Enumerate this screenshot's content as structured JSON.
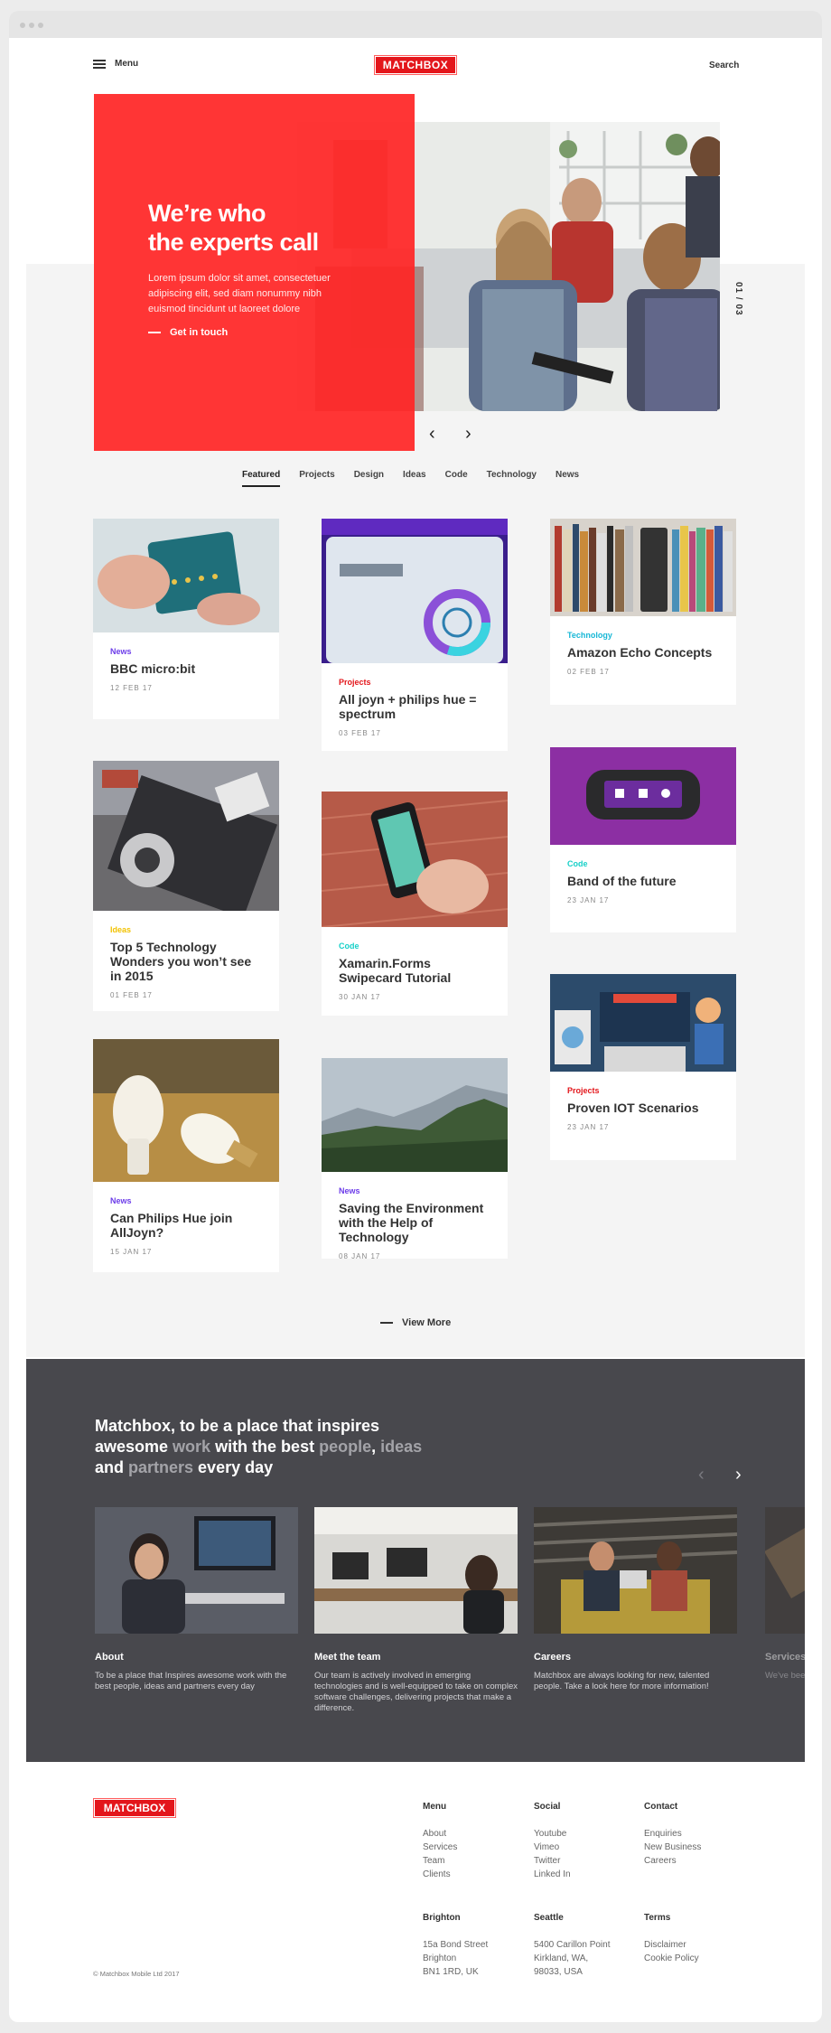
{
  "header": {
    "menu_label": "Menu",
    "logo": "MATCHBOX",
    "search_label": "Search"
  },
  "hero": {
    "title_line1": "We’re who",
    "title_line2": "the experts call",
    "body": "Lorem ipsum dolor sit amet, consectetuer adipiscing elit, sed diam nonummy nibh euismod tincidunt ut laoreet dolore",
    "cta": "Get in touch",
    "slide_counter": "01 / 03",
    "prev_icon": "chevron-left-icon",
    "next_icon": "chevron-right-icon"
  },
  "tabs": [
    "Featured",
    "Projects",
    "Design",
    "Ideas",
    "Code",
    "Technology",
    "News"
  ],
  "colors": {
    "brand_red": "#e3161b",
    "news": "#6c3ce9",
    "projects": "#e3161b",
    "technology": "#17b7d6",
    "code": "#17d0c8",
    "ideas": "#f2c200",
    "dark_bg": "#48484d"
  },
  "cards": [
    {
      "category": "News",
      "title": "BBC micro:bit",
      "date": "12 FEB 17"
    },
    {
      "category": "Projects",
      "title": "All joyn + philips hue = spectrum",
      "date": "03 FEB 17"
    },
    {
      "category": "Technology",
      "title": "Amazon Echo Concepts",
      "date": "02 FEB 17"
    },
    {
      "category": "Ideas",
      "title": "Top 5 Technology Wonders you won’t see in 2015",
      "date": "01 FEB 17"
    },
    {
      "category": "Code",
      "title": "Xamarin.Forms Swipecard Tutorial",
      "date": "30 JAN 17"
    },
    {
      "category": "Code",
      "title": "Band of the future",
      "date": "23 JAN 17"
    },
    {
      "category": "News",
      "title": "Can Philips Hue join AllJoyn?",
      "date": "15 JAN 17"
    },
    {
      "category": "News",
      "title": "Saving the Environment with the Help of Technology",
      "date": "08 JAN 17"
    },
    {
      "category": "Projects",
      "title": "Proven IOT Scenarios",
      "date": "23 JAN 17"
    }
  ],
  "view_more": "View More",
  "about": {
    "tagline_1": "Matchbox, to be a place that inspires",
    "tagline_2a": "awesome ",
    "tagline_2b": "work",
    "tagline_2c": " with the best ",
    "tagline_2d": "people",
    "tagline_2e": ", ",
    "tagline_2f": "ideas",
    "tagline_3a": "and ",
    "tagline_3b": "partners",
    "tagline_3c": " every day",
    "panels": [
      {
        "title": "About",
        "body": "To be a place that Inspires awesome work with the best people, ideas and partners every day"
      },
      {
        "title": "Meet the team",
        "body": "Our team is actively involved in emerging technologies and is well-equipped to take on complex software challenges, delivering projects that make a difference."
      },
      {
        "title": "Careers",
        "body": "Matchbox are always looking for new, talented people. Take a look here for more information!"
      },
      {
        "title": "Services",
        "body": "We've been d development when real sk"
      }
    ]
  },
  "footer": {
    "logo": "MATCHBOX",
    "menu": {
      "heading": "Menu",
      "links": [
        "About",
        "Services",
        "Team",
        "Clients"
      ]
    },
    "social": {
      "heading": "Social",
      "links": [
        "Youtube",
        "Vimeo",
        "Twitter",
        "Linked In"
      ]
    },
    "contact": {
      "heading": "Contact",
      "links": [
        "Enquiries",
        "New Business",
        "Careers"
      ]
    },
    "brighton": {
      "heading": "Brighton",
      "lines": [
        "15a Bond Street",
        "Brighton",
        "BN1 1RD, UK"
      ]
    },
    "seattle": {
      "heading": "Seattle",
      "lines": [
        "5400 Carillon Point",
        "Kirkland, WA,",
        "98033, USA"
      ]
    },
    "terms": {
      "heading": "Terms",
      "links": [
        "Disclaimer",
        "Cookie Policy"
      ]
    },
    "copyright": "© Matchbox Mobile Ltd 2017"
  }
}
